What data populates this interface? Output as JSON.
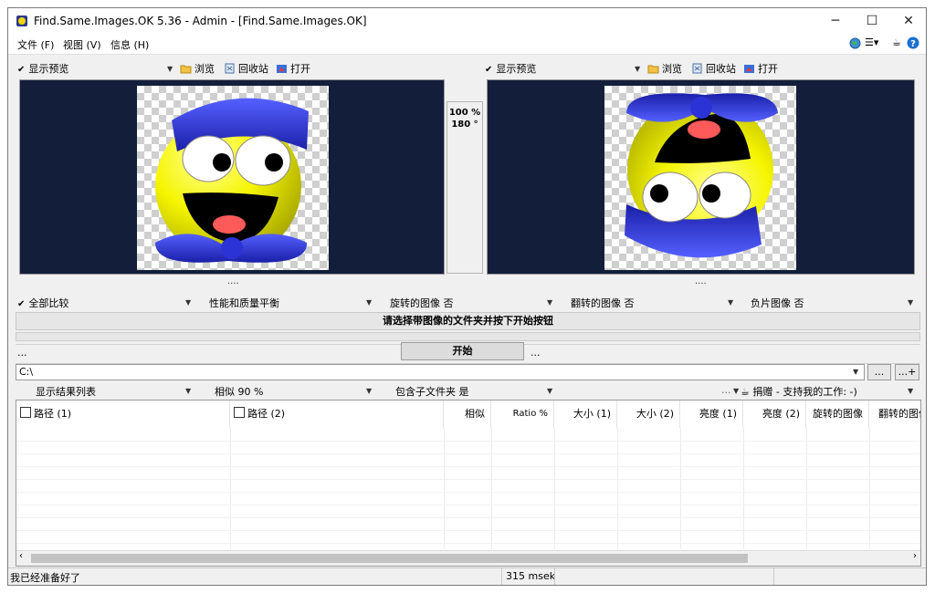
{
  "window": {
    "title": "Find.Same.Images.OK 5.36 - Admin - [Find.Same.Images.OK]",
    "minimize": "─",
    "maximize": "☐",
    "close": "✕"
  },
  "menu": {
    "file": "文件 (F)",
    "view": "视图 (V)",
    "info": "信息 (H)"
  },
  "toolbar_left": {
    "preview": "显示预览",
    "browse": "浏览",
    "recycle": "回收站",
    "open": "打开"
  },
  "toolbar_right": {
    "preview": "显示预览",
    "browse": "浏览",
    "recycle": "回收站",
    "open": "打开"
  },
  "compare_info": {
    "zoom": "100 %",
    "rotation": "180 °"
  },
  "dots": "....",
  "options": {
    "compare_all": "全部比较",
    "performance": "性能和质量平衡",
    "rotated": "旋转的图像 否",
    "flipped": "翻转的图像 否",
    "negative": "负片图像 否"
  },
  "status_message": "请选择带图像的文件夹并按下开始按钮",
  "start": {
    "label": "开始",
    "left_dots": "...",
    "right_dots": "..."
  },
  "path": {
    "value": "C:\\",
    "browse_btn": "...",
    "add_btn": "...+"
  },
  "results_bar": {
    "show_list": "显示结果列表",
    "similar": "相似 90 %",
    "subfolders": "包含子文件夹 是",
    "donate_prefix": "...",
    "donate": "捐赠 - 支持我的工作: -)"
  },
  "columns": [
    "路径 (1)",
    "路径 (2)",
    "相似",
    "Ratio %",
    "大小 (1)",
    "大小 (2)",
    "亮度 (1)",
    "亮度 (2)",
    "旋转的图像",
    "翻转的图像"
  ],
  "statusbar": {
    "ready": "我已经准备好了",
    "time": "315 msek"
  },
  "colors": {
    "preview_bg": "#131e3a",
    "smiley_yellow": "#f5f500",
    "hat_blue": "#2b33d6",
    "mouth_red": "#ff5a5a"
  }
}
